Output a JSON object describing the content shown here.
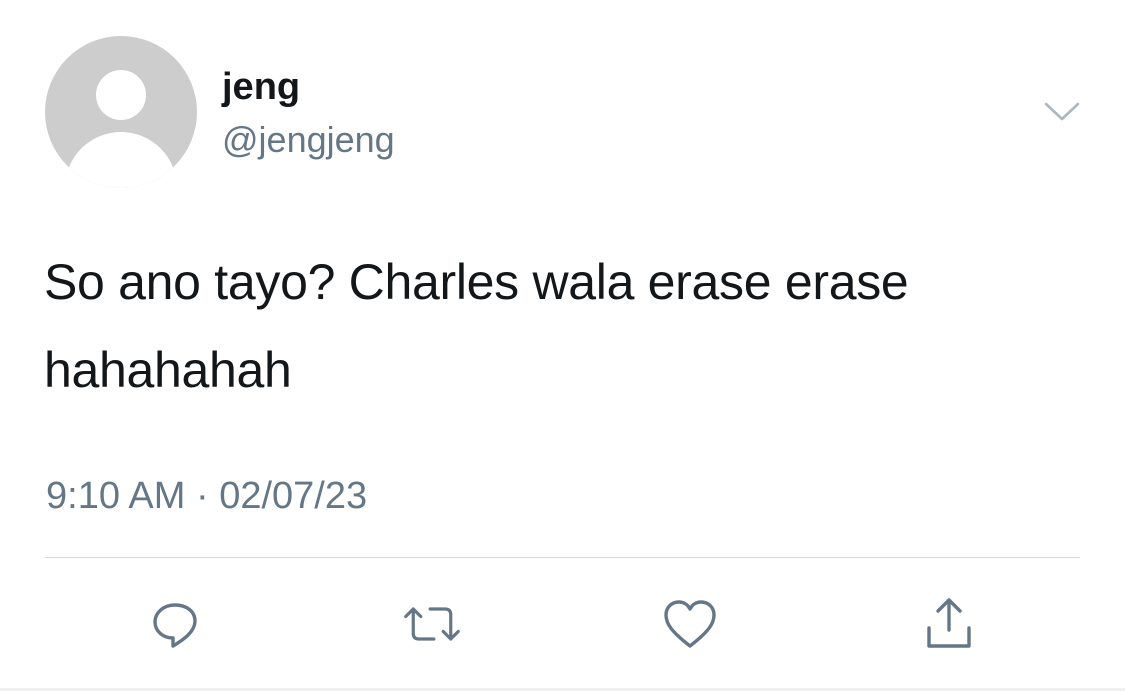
{
  "tweet": {
    "author": {
      "display_name": "jeng",
      "handle": "@jengjeng"
    },
    "text_line1": "So ano tayo? Charles wala erase erase",
    "text_line2": "hahahahah",
    "time": "9:10 AM",
    "separator": "·",
    "date": "02/07/23"
  },
  "icons": {
    "menu": "chevron-down-icon",
    "reply": "reply-icon",
    "retweet": "retweet-icon",
    "like": "heart-icon",
    "share": "share-icon"
  },
  "colors": {
    "text_primary": "#14171a",
    "text_secondary": "#657786",
    "icon": "#657786",
    "divider": "#d6dbdf",
    "avatar_placeholder": "#cdcdcd"
  }
}
